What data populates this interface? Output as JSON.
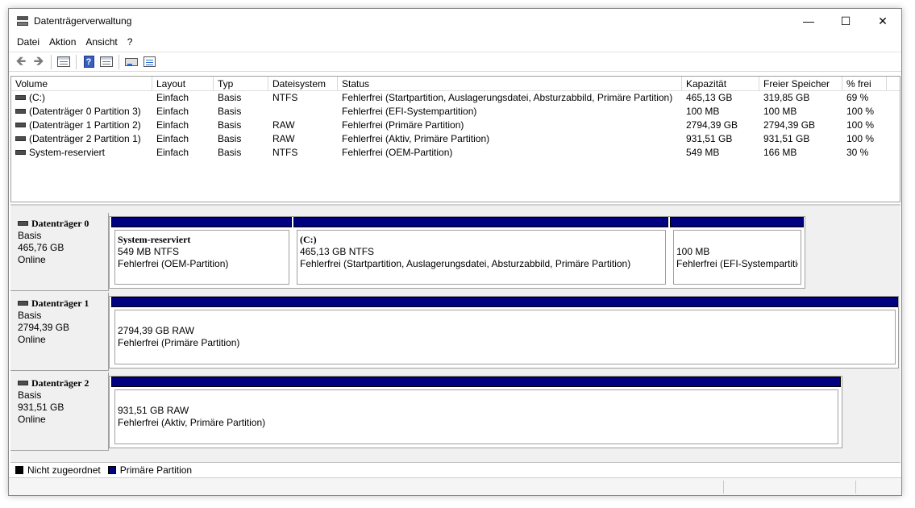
{
  "window": {
    "title": "Datenträgerverwaltung",
    "minimize": "—",
    "maximize": "☐",
    "close": "✕"
  },
  "menu": [
    "Datei",
    "Aktion",
    "Ansicht",
    "?"
  ],
  "toolbar": {
    "back": "🡸",
    "forward": "🡺"
  },
  "volumes": {
    "headers": [
      "Volume",
      "Layout",
      "Typ",
      "Dateisystem",
      "Status",
      "Kapazität",
      "Freier Speicher",
      "% frei"
    ],
    "rows": [
      [
        "(C:)",
        "Einfach",
        "Basis",
        "NTFS",
        "Fehlerfrei (Startpartition, Auslagerungsdatei, Absturzabbild, Primäre Partition)",
        "465,13 GB",
        "319,85 GB",
        "69 %"
      ],
      [
        "(Datenträger 0 Partition 3)",
        "Einfach",
        "Basis",
        "",
        "Fehlerfrei (EFI-Systempartition)",
        "100 MB",
        "100 MB",
        "100 %"
      ],
      [
        "(Datenträger 1 Partition 2)",
        "Einfach",
        "Basis",
        "RAW",
        "Fehlerfrei (Primäre Partition)",
        "2794,39 GB",
        "2794,39 GB",
        "100 %"
      ],
      [
        "(Datenträger 2 Partition 1)",
        "Einfach",
        "Basis",
        "RAW",
        "Fehlerfrei (Aktiv, Primäre Partition)",
        "931,51 GB",
        "931,51 GB",
        "100 %"
      ],
      [
        "System-reserviert",
        "Einfach",
        "Basis",
        "NTFS",
        "Fehlerfrei (OEM-Partition)",
        "549 MB",
        "166 MB",
        "30 %"
      ]
    ]
  },
  "disks": [
    {
      "name": "Datenträger 0",
      "type": "Basis",
      "size": "465,76 GB",
      "state": "Online",
      "partitions": [
        {
          "title": "System-reserviert",
          "detail": "549 MB NTFS",
          "status": "Fehlerfrei (OEM-Partition)"
        },
        {
          "title": "(C:)",
          "detail": "465,13 GB NTFS",
          "status": "Fehlerfrei (Startpartition, Auslagerungsdatei, Absturzabbild, Primäre Partition)"
        },
        {
          "title": "",
          "detail": "100 MB",
          "status": "Fehlerfrei (EFI-Systempartitio"
        }
      ]
    },
    {
      "name": "Datenträger 1",
      "type": "Basis",
      "size": "2794,39 GB",
      "state": "Online",
      "partitions": [
        {
          "title": "",
          "detail": "2794,39 GB RAW",
          "status": "Fehlerfrei (Primäre Partition)"
        }
      ]
    },
    {
      "name": "Datenträger 2",
      "type": "Basis",
      "size": "931,51 GB",
      "state": "Online",
      "partitions": [
        {
          "title": "",
          "detail": "931,51 GB RAW",
          "status": "Fehlerfrei (Aktiv, Primäre Partition)"
        }
      ]
    }
  ],
  "legend": [
    {
      "label": "Nicht zugeordnet",
      "color": "#000000"
    },
    {
      "label": "Primäre Partition",
      "color": "#000080"
    }
  ]
}
